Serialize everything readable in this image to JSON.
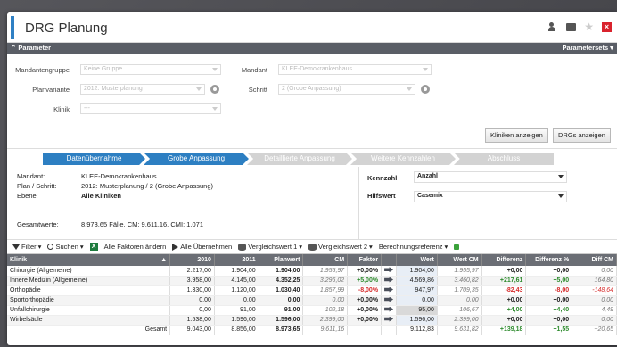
{
  "window": {
    "title": "DRG Planung"
  },
  "params": {
    "header": "Parameter",
    "sets": "Parametersets",
    "mandantengruppe_label": "Mandantengruppe",
    "mandantengruppe_value": "Keine Gruppe",
    "mandant_label": "Mandant",
    "mandant_value": "KLEE-Demokrankenhaus",
    "planvariante_label": "Planvariante",
    "planvariante_value": "2012: Musterplanung",
    "schritt_label": "Schritt",
    "schritt_value": "2 (Grobe Anpassung)",
    "klinik_label": "Klinik",
    "klinik_value": "---",
    "btn_kliniken": "Kliniken anzeigen",
    "btn_drgs": "DRGs anzeigen"
  },
  "steps": [
    "Datenübernahme",
    "Grobe Anpassung",
    "Detaillierte Anpassung",
    "Weitere Kennzahlen",
    "Abschluss"
  ],
  "info": {
    "mandant_k": "Mandant:",
    "mandant_v": "KLEE-Demokrankenhaus",
    "plan_k": "Plan / Schritt:",
    "plan_v": "2012: Musterplanung / 2 (Grobe Anpassung)",
    "ebene_k": "Ebene:",
    "ebene_v": "Alle Kliniken",
    "gesamt_k": "Gesamtwerte:",
    "gesamt_v": "8.973,65 Fälle, CM: 9.611,16, CMI: 1,071",
    "kennzahl_k": "Kennzahl",
    "kennzahl_v": "Anzahl",
    "hilfswert_k": "Hilfswert",
    "hilfswert_v": "Casemix"
  },
  "toolbar": {
    "filter": "Filter",
    "suchen": "Suchen",
    "faktoren": "Alle Faktoren ändern",
    "uebernehmen": "Alle Übernehmen",
    "vergleich1": "Vergleichswert 1",
    "vergleich2": "Vergleichswert 2",
    "berechnung": "Berechnungsreferenz"
  },
  "table": {
    "headers": [
      "Klinik",
      "2010",
      "2011",
      "Planwert",
      "CM",
      "Faktor",
      "",
      "Wert",
      "Wert CM",
      "Differenz",
      "Differenz %",
      "Diff CM"
    ],
    "rows": [
      [
        "Chirurgie (Allgemeine)",
        "2.217,00",
        "1.904,00",
        "1.904,00",
        "1.955,97",
        "+0,00%",
        "",
        "1.904,00",
        "1.955,97",
        "+0,00",
        "+0,00",
        "0,00"
      ],
      [
        "Innere Medizin (Allgemeine)",
        "3.958,00",
        "4.145,00",
        "4.352,25",
        "3.296,02",
        "+5,00%",
        "",
        "4.569,86",
        "3.460,82",
        "+217,61",
        "+5,00",
        "164,80"
      ],
      [
        "Orthopädie",
        "1.330,00",
        "1.120,00",
        "1.030,40",
        "1.857,99",
        "-8,00%",
        "",
        "947,97",
        "1.709,35",
        "-82,43",
        "-8,00",
        "-148,64"
      ],
      [
        "Sportorthopädie",
        "0,00",
        "0,00",
        "0,00",
        "0,00",
        "+0,00%",
        "",
        "0,00",
        "0,00",
        "+0,00",
        "+0,00",
        "0,00"
      ],
      [
        "Unfallchirurgie",
        "0,00",
        "91,00",
        "91,00",
        "102,18",
        "+0,00%",
        "",
        "95,00",
        "106,67",
        "+4,00",
        "+4,40",
        "4,49"
      ],
      [
        "Wirbelsäule",
        "1.538,00",
        "1.596,00",
        "1.596,00",
        "2.399,00",
        "+0,00%",
        "",
        "1.596,00",
        "2.399,00",
        "+0,00",
        "+0,00",
        "0,00"
      ]
    ],
    "totals": [
      "Gesamt",
      "9.043,00",
      "8.856,00",
      "8.973,65",
      "9.611,16",
      "",
      "",
      "9.112,83",
      "9.631,82",
      "+139,18",
      "+1,55",
      "+20,65"
    ]
  }
}
